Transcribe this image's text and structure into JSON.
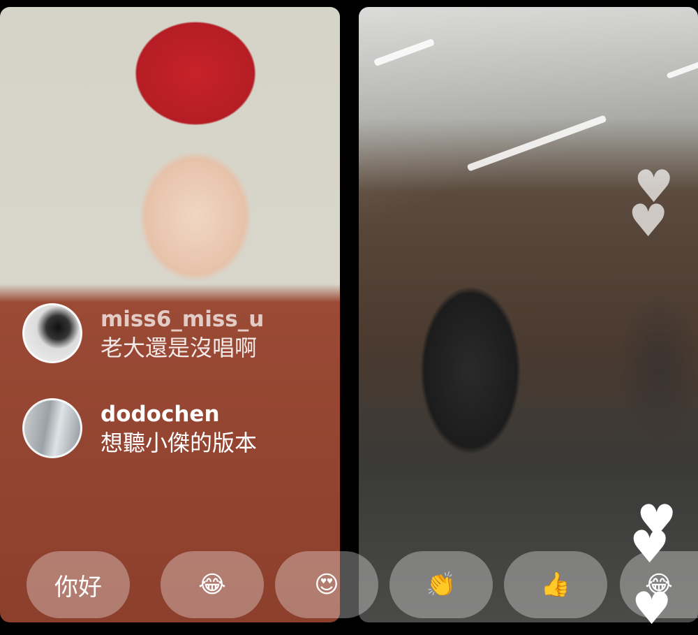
{
  "comments": [
    {
      "username": "miss6_miss_u",
      "message": "老大還是沒唱啊"
    },
    {
      "username": "dodochen",
      "message": "想聽小傑的版本"
    }
  ],
  "quick_replies": [
    {
      "label": "你好",
      "icon": "text"
    },
    {
      "label": "😂",
      "icon": "tears-of-joy-emoji"
    },
    {
      "label": "😍",
      "icon": "heart-eyes-emoji"
    },
    {
      "label": "👏",
      "icon": "clapping-hands-emoji"
    },
    {
      "label": "👍",
      "icon": "thumbs-up-emoji"
    },
    {
      "label": "😂",
      "icon": "tears-of-joy-emoji"
    }
  ],
  "reaction_icon": "heart-icon",
  "colors": {
    "background": "#000000",
    "chip": "rgba(255,255,255,0.32)",
    "text": "#ffffff"
  }
}
